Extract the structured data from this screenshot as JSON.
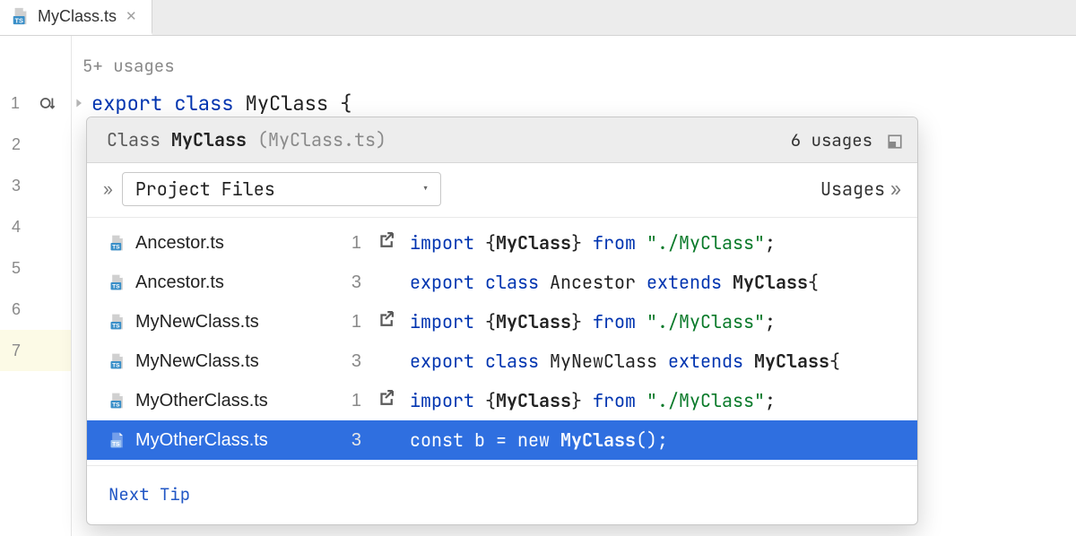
{
  "tab": {
    "filename": "MyClass.ts"
  },
  "gutter": {
    "lines": [
      1,
      2,
      3,
      4,
      5,
      6,
      7
    ],
    "current": 7
  },
  "hint": "5+ usages",
  "code_line": {
    "kw1": "export",
    "kw2": "class",
    "name": "MyClass",
    "brace": "{"
  },
  "popup": {
    "header": {
      "prefix": "Class",
      "name": "MyClass",
      "paren_file": "(MyClass.ts)",
      "count": "6 usages"
    },
    "subbar": {
      "scope": "Project Files",
      "right": "Usages"
    },
    "rows": [
      {
        "file": "Ancestor.ts",
        "line": "1",
        "kind": "import",
        "snippet": {
          "type": "import",
          "sym": "MyClass",
          "from": "\"./MyClass\""
        },
        "selected": false
      },
      {
        "file": "Ancestor.ts",
        "line": "3",
        "kind": "",
        "snippet": {
          "type": "extends",
          "cls": "Ancestor",
          "base": "MyClass"
        },
        "selected": false
      },
      {
        "file": "MyNewClass.ts",
        "line": "1",
        "kind": "import",
        "snippet": {
          "type": "import",
          "sym": "MyClass",
          "from": "\"./MyClass\""
        },
        "selected": false
      },
      {
        "file": "MyNewClass.ts",
        "line": "3",
        "kind": "",
        "snippet": {
          "type": "extends",
          "cls": "MyNewClass",
          "base": "MyClass"
        },
        "selected": false
      },
      {
        "file": "MyOtherClass.ts",
        "line": "1",
        "kind": "import",
        "snippet": {
          "type": "import",
          "sym": "MyClass",
          "from": "\"./MyClass\""
        },
        "selected": false
      },
      {
        "file": "MyOtherClass.ts",
        "line": "3",
        "kind": "",
        "snippet": {
          "type": "new",
          "lhs": "const b = new ",
          "base": "MyClass",
          "tail": "();"
        },
        "selected": true
      }
    ],
    "footer_link": "Next Tip"
  }
}
